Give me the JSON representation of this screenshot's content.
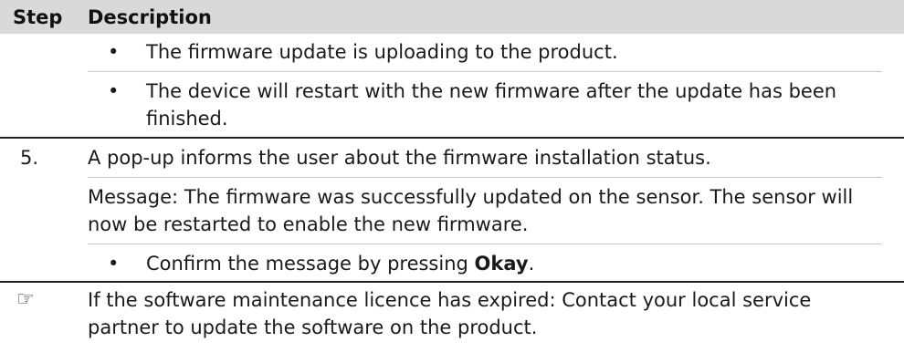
{
  "header": {
    "step_label": "Step",
    "description_label": "Description"
  },
  "rows": [
    {
      "step": "",
      "bullets": [
        "The firmware update is uploading to the product.",
        "The device will restart with the new firmware after the update has been finished."
      ]
    },
    {
      "step": "5.",
      "paragraphs": [
        "A pop-up informs the user about the firmware installation status.",
        "Message: The firmware was successfully updated on the sensor. The sensor will now be restarted to enable the new firmware."
      ],
      "bullet_prefix": "Confirm the message by pressing ",
      "bullet_bold": "Okay",
      "bullet_suffix": "."
    },
    {
      "step_icon": "pointing-hand-icon",
      "step_symbol": "☞",
      "note": "If the software maintenance licence has expired: Contact your local service partner to update the software on the product."
    }
  ],
  "bullet_char": "•"
}
